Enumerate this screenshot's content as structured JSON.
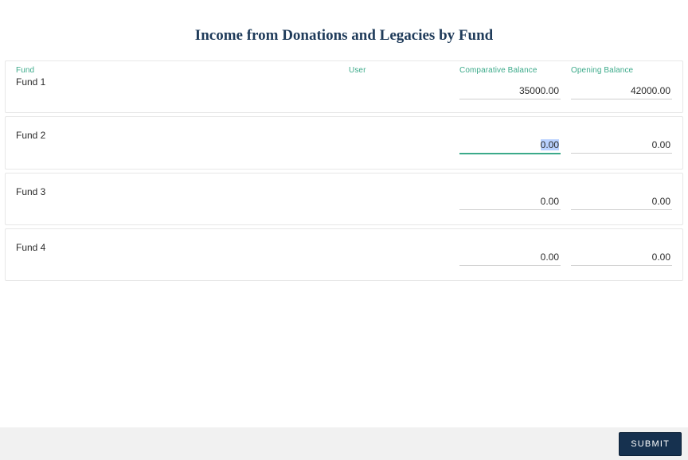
{
  "title": "Income from Donations and Legacies by Fund",
  "columns": {
    "fund": "Fund",
    "user": "User",
    "comparative": "Comparative Balance",
    "opening": "Opening Balance"
  },
  "rows": [
    {
      "name": "Fund 1",
      "comparative": "35000.00",
      "opening": "42000.00"
    },
    {
      "name": "Fund 2",
      "comparative": "0.00",
      "opening": "0.00"
    },
    {
      "name": "Fund 3",
      "comparative": "0.00",
      "opening": "0.00"
    },
    {
      "name": "Fund 4",
      "comparative": "0.00",
      "opening": "0.00"
    }
  ],
  "active_input": {
    "row": 1,
    "field": "comparative"
  },
  "submit_label": "SUBMIT"
}
